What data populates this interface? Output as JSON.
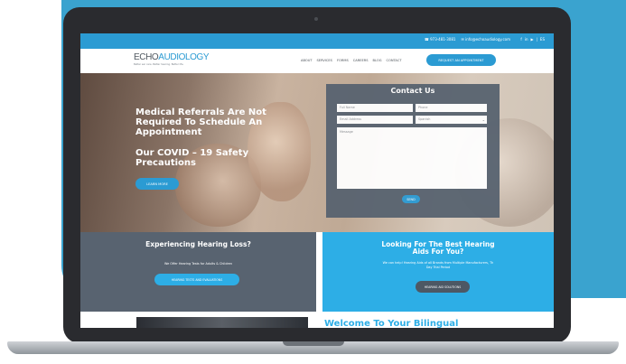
{
  "contact_bar": {
    "phone": "☎ 973-481-3081",
    "email": "✉ info@echoaudiology.com",
    "social": [
      "f",
      "in",
      "▶",
      "|",
      "ES"
    ]
  },
  "brand": {
    "logo_left": "ECHO",
    "logo_right": "AUDIOLOGY",
    "tagline": "Better ear care. Better hearing. Better life."
  },
  "nav": {
    "items": [
      "ABOUT",
      "SERVICES",
      "FORMS",
      "CAREERS",
      "BLOG",
      "CONTACT"
    ],
    "cta": "REQUEST AN APPOINTMENT"
  },
  "hero": {
    "title": "Medical Referrals Are Not Required To Schedule An Appointment",
    "subtitle": "Our COVID – 19 Safety Precautions",
    "button": "LEARN MORE"
  },
  "contact_form": {
    "title": "Contact Us",
    "name_placeholder": "Full Name",
    "phone_placeholder": "Phone",
    "email_placeholder": "Email Address",
    "language_value": "Spanish",
    "message_placeholder": "Message",
    "send_label": "SEND"
  },
  "band_left": {
    "title": "Experiencing Hearing Loss?",
    "text": "We Offer Hearing Tests for Adults & Children",
    "button": "HEARING TESTS AND EVALUATIONS"
  },
  "band_right": {
    "title": "Looking For The Best Hearing Aids For You?",
    "text": "We can help! Hearing Aids of all Brands from Multiple Manufacturers, Th Day Trial Period",
    "button": "HEARING AID SOLUTIONS"
  },
  "welcome": {
    "title": "Welcome To Your Bilingual"
  }
}
